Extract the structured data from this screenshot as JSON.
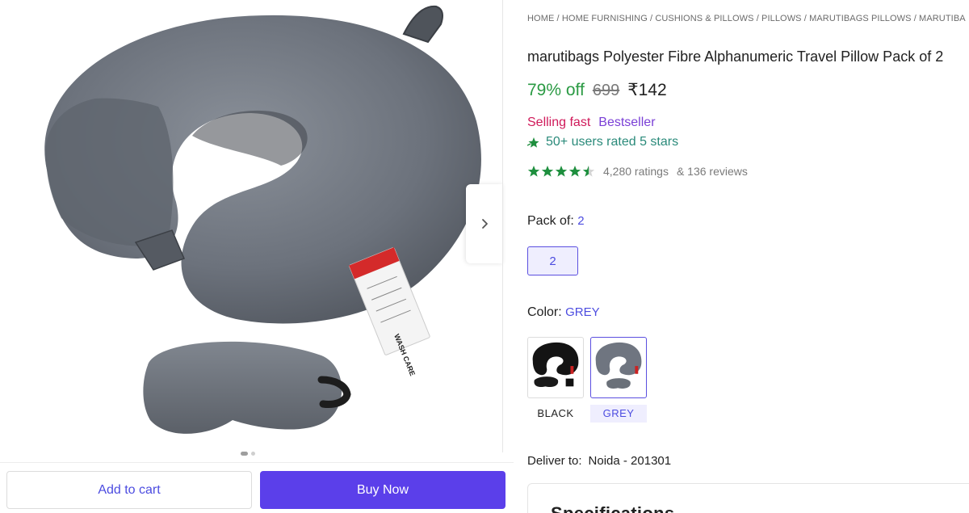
{
  "breadcrumb": {
    "text": "HOME / HOME FURNISHING / CUSHIONS & PILLOWS / PILLOWS / MARUTIBAGS PILLOWS / MARUTIBA"
  },
  "product": {
    "title": "marutibags Polyester Fibre Alphanumeric Travel Pillow Pack of 2",
    "discount": "79% off",
    "mrp": "699",
    "price": "₹142",
    "selling_fast": "Selling fast",
    "bestseller": "Bestseller",
    "rated_text": "50+ users rated 5 stars",
    "rating_stars": 4.5,
    "ratings_count": "4,280 ratings",
    "reviews_count": "& 136 reviews"
  },
  "pack": {
    "label": "Pack of:",
    "selected": "2",
    "options": [
      "2"
    ]
  },
  "color": {
    "label": "Color:",
    "selected": "GREY",
    "options": [
      "BLACK",
      "GREY"
    ]
  },
  "delivery": {
    "label": "Deliver to:",
    "location": "Noida - 201301"
  },
  "specifications": {
    "title": "Specifications"
  },
  "actions": {
    "add_to_cart": "Add to cart",
    "buy_now": "Buy Now"
  },
  "gallery": {
    "current_index": 1,
    "total_images": 2,
    "wash_care_text": "WASH CARE"
  },
  "colors": {
    "accent": "#5b3fea",
    "discount_green": "#2a9a43",
    "selling_fast": "#d01a5a",
    "bestseller": "#7a3fd6",
    "star_green": "#1e8f3e",
    "pillow_grey": "#6f7580"
  }
}
